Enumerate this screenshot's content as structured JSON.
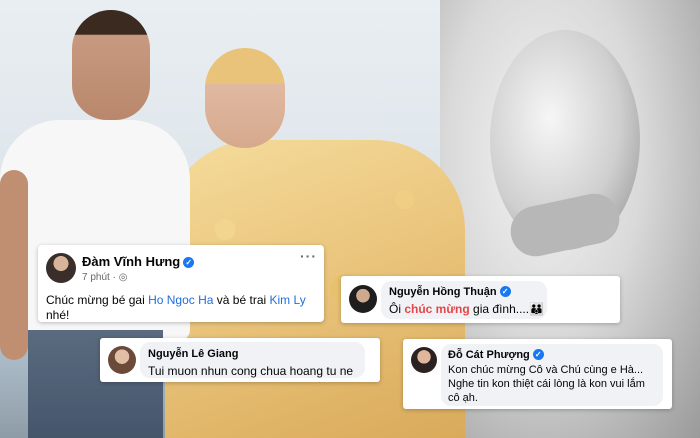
{
  "post": {
    "author": "Đàm Vĩnh Hưng",
    "time": "7 phút · ",
    "more_icon": "more-dots-icon",
    "globe_icon": "globe-icon",
    "text_start": "Chúc mừng bé gai ",
    "link1": "Ho Ngoc Ha",
    "text_mid": " và bé trai ",
    "link2": "Kim Ly",
    "text_end": "nhé!"
  },
  "comment_thuan": {
    "author": "Nguyễn Hồng Thuận",
    "text_start": "Ôi ",
    "highlight": "chúc mừng",
    "text_end": " gia đình....",
    "emoji": "👪"
  },
  "comment_giang": {
    "author": "Nguyễn Lê Giang",
    "text": "Tui muon nhun cong chua hoang tu ne"
  },
  "comment_phuong": {
    "author": "Đỗ Cát Phượng",
    "line1": "Kon chúc mừng Cô và Chú cùng e Hà...",
    "line2": "Nghe tin kon thiệt cái lòng là kon vui lắm",
    "line3": "cô ạh."
  },
  "icons": {
    "verified": "verified-badge-icon"
  },
  "colors": {
    "link": "#216fdb",
    "highlight": "#e4464a",
    "verified": "#1877f2"
  }
}
